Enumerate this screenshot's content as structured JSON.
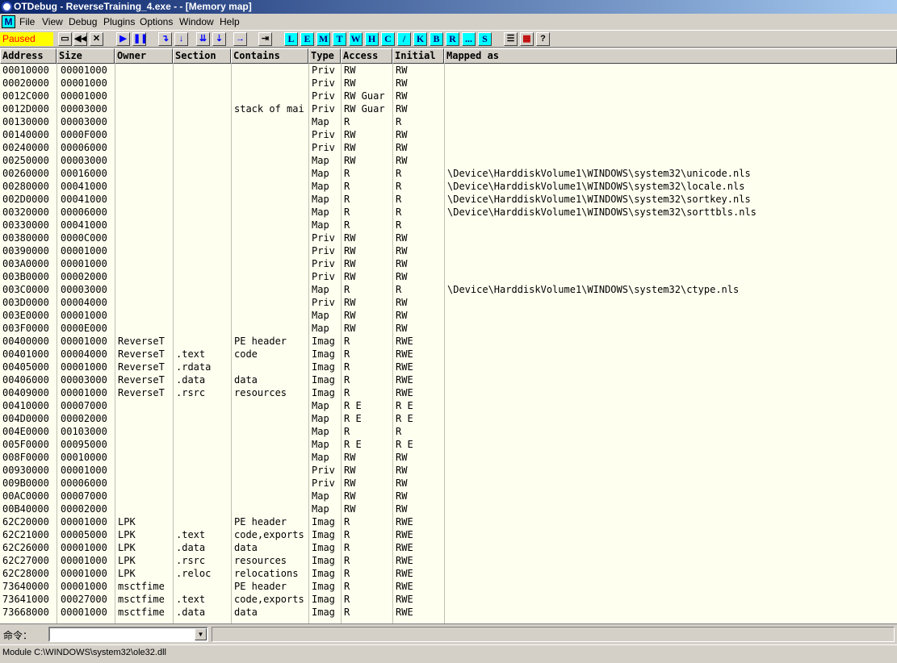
{
  "window": {
    "title": "OTDebug - ReverseTraining_4.exe - - [Memory map]"
  },
  "menu": {
    "mdi_label": "M",
    "items": [
      "File",
      "View",
      "Debug",
      "Plugins",
      "Options",
      "Window",
      "Help"
    ]
  },
  "toolbar": {
    "status": "Paused",
    "letters": [
      "L",
      "E",
      "M",
      "T",
      "W",
      "H",
      "C",
      "/",
      "K",
      "B",
      "R",
      "...",
      "S"
    ],
    "help": "?"
  },
  "columns": [
    "Address",
    "Size",
    "Owner",
    "Section",
    "Contains",
    "Type",
    "Access",
    "Initial",
    "Mapped as"
  ],
  "rows": [
    [
      "00010000",
      "00001000",
      "",
      "",
      "",
      "Priv",
      "RW",
      "RW",
      ""
    ],
    [
      "00020000",
      "00001000",
      "",
      "",
      "",
      "Priv",
      "RW",
      "RW",
      ""
    ],
    [
      "0012C000",
      "00001000",
      "",
      "",
      "",
      "Priv",
      "RW  Guar",
      "RW",
      ""
    ],
    [
      "0012D000",
      "00003000",
      "",
      "",
      "stack of mai",
      "Priv",
      "RW  Guar",
      "RW",
      ""
    ],
    [
      "00130000",
      "00003000",
      "",
      "",
      "",
      "Map",
      "R",
      "R",
      ""
    ],
    [
      "00140000",
      "0000F000",
      "",
      "",
      "",
      "Priv",
      "RW",
      "RW",
      ""
    ],
    [
      "00240000",
      "00006000",
      "",
      "",
      "",
      "Priv",
      "RW",
      "RW",
      ""
    ],
    [
      "00250000",
      "00003000",
      "",
      "",
      "",
      "Map",
      "RW",
      "RW",
      ""
    ],
    [
      "00260000",
      "00016000",
      "",
      "",
      "",
      "Map",
      "R",
      "R",
      "\\Device\\HarddiskVolume1\\WINDOWS\\system32\\unicode.nls"
    ],
    [
      "00280000",
      "00041000",
      "",
      "",
      "",
      "Map",
      "R",
      "R",
      "\\Device\\HarddiskVolume1\\WINDOWS\\system32\\locale.nls"
    ],
    [
      "002D0000",
      "00041000",
      "",
      "",
      "",
      "Map",
      "R",
      "R",
      "\\Device\\HarddiskVolume1\\WINDOWS\\system32\\sortkey.nls"
    ],
    [
      "00320000",
      "00006000",
      "",
      "",
      "",
      "Map",
      "R",
      "R",
      "\\Device\\HarddiskVolume1\\WINDOWS\\system32\\sorttbls.nls"
    ],
    [
      "00330000",
      "00041000",
      "",
      "",
      "",
      "Map",
      "R",
      "R",
      ""
    ],
    [
      "00380000",
      "0000C000",
      "",
      "",
      "",
      "Priv",
      "RW",
      "RW",
      ""
    ],
    [
      "00390000",
      "00001000",
      "",
      "",
      "",
      "Priv",
      "RW",
      "RW",
      ""
    ],
    [
      "003A0000",
      "00001000",
      "",
      "",
      "",
      "Priv",
      "RW",
      "RW",
      ""
    ],
    [
      "003B0000",
      "00002000",
      "",
      "",
      "",
      "Priv",
      "RW",
      "RW",
      ""
    ],
    [
      "003C0000",
      "00003000",
      "",
      "",
      "",
      "Map",
      "R",
      "R",
      "\\Device\\HarddiskVolume1\\WINDOWS\\system32\\ctype.nls"
    ],
    [
      "003D0000",
      "00004000",
      "",
      "",
      "",
      "Priv",
      "RW",
      "RW",
      ""
    ],
    [
      "003E0000",
      "00001000",
      "",
      "",
      "",
      "Map",
      "RW",
      "RW",
      ""
    ],
    [
      "003F0000",
      "0000E000",
      "",
      "",
      "",
      "Map",
      "RW",
      "RW",
      ""
    ],
    [
      "00400000",
      "00001000",
      "ReverseT",
      "",
      "PE header",
      "Imag",
      "R",
      "RWE",
      ""
    ],
    [
      "00401000",
      "00004000",
      "ReverseT",
      ".text",
      "code",
      "Imag",
      "R",
      "RWE",
      ""
    ],
    [
      "00405000",
      "00001000",
      "ReverseT",
      ".rdata",
      "",
      "Imag",
      "R",
      "RWE",
      ""
    ],
    [
      "00406000",
      "00003000",
      "ReverseT",
      ".data",
      "data",
      "Imag",
      "R",
      "RWE",
      ""
    ],
    [
      "00409000",
      "00001000",
      "ReverseT",
      ".rsrc",
      "resources",
      "Imag",
      "R",
      "RWE",
      ""
    ],
    [
      "00410000",
      "00007000",
      "",
      "",
      "",
      "Map",
      "R E",
      "R E",
      ""
    ],
    [
      "004D0000",
      "00002000",
      "",
      "",
      "",
      "Map",
      "R E",
      "R E",
      ""
    ],
    [
      "004E0000",
      "00103000",
      "",
      "",
      "",
      "Map",
      "R",
      "R",
      ""
    ],
    [
      "005F0000",
      "00095000",
      "",
      "",
      "",
      "Map",
      "R E",
      "R E",
      ""
    ],
    [
      "008F0000",
      "00010000",
      "",
      "",
      "",
      "Map",
      "RW",
      "RW",
      ""
    ],
    [
      "00930000",
      "00001000",
      "",
      "",
      "",
      "Priv",
      "RW",
      "RW",
      ""
    ],
    [
      "009B0000",
      "00006000",
      "",
      "",
      "",
      "Priv",
      "RW",
      "RW",
      ""
    ],
    [
      "00AC0000",
      "00007000",
      "",
      "",
      "",
      "Map",
      "RW",
      "RW",
      ""
    ],
    [
      "00B40000",
      "00002000",
      "",
      "",
      "",
      "Map",
      "RW",
      "RW",
      ""
    ],
    [
      "62C20000",
      "00001000",
      "LPK",
      "",
      "PE header",
      "Imag",
      "R",
      "RWE",
      ""
    ],
    [
      "62C21000",
      "00005000",
      "LPK",
      ".text",
      "code,exports",
      "Imag",
      "R",
      "RWE",
      ""
    ],
    [
      "62C26000",
      "00001000",
      "LPK",
      ".data",
      "data",
      "Imag",
      "R",
      "RWE",
      ""
    ],
    [
      "62C27000",
      "00001000",
      "LPK",
      ".rsrc",
      "resources",
      "Imag",
      "R",
      "RWE",
      ""
    ],
    [
      "62C28000",
      "00001000",
      "LPK",
      ".reloc",
      "relocations",
      "Imag",
      "R",
      "RWE",
      ""
    ],
    [
      "73640000",
      "00001000",
      "msctfime",
      "",
      "PE header",
      "Imag",
      "R",
      "RWE",
      ""
    ],
    [
      "73641000",
      "00027000",
      "msctfime",
      ".text",
      "code,exports",
      "Imag",
      "R",
      "RWE",
      ""
    ],
    [
      "73668000",
      "00001000",
      "msctfime",
      ".data",
      "data",
      "Imag",
      "R",
      "RWE",
      ""
    ]
  ],
  "command": {
    "label": "命令：",
    "value": ""
  },
  "statusbar": {
    "text": "Module C:\\WINDOWS\\system32\\ole32.dll"
  }
}
